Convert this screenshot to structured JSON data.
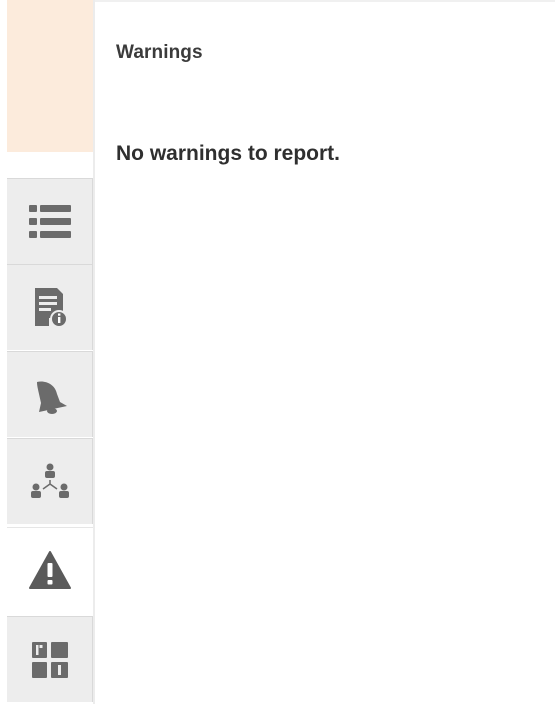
{
  "panel": {
    "title": "Warnings",
    "message": "No warnings to report."
  },
  "sidebar": {
    "tabs": [
      {
        "icon": "list-icon",
        "active": false
      },
      {
        "icon": "document-info-icon",
        "active": false
      },
      {
        "icon": "bell-icon",
        "active": false
      },
      {
        "icon": "hierarchy-icon",
        "active": false
      },
      {
        "icon": "warning-icon",
        "active": true
      },
      {
        "icon": "layout-tiles-icon",
        "active": false
      }
    ]
  },
  "colors": {
    "header_background": "#fcebdc",
    "tab_background": "#ededed",
    "icon_gray": "#6b6b6b",
    "warning_icon": "#5a5a5a",
    "text": "#333333"
  }
}
